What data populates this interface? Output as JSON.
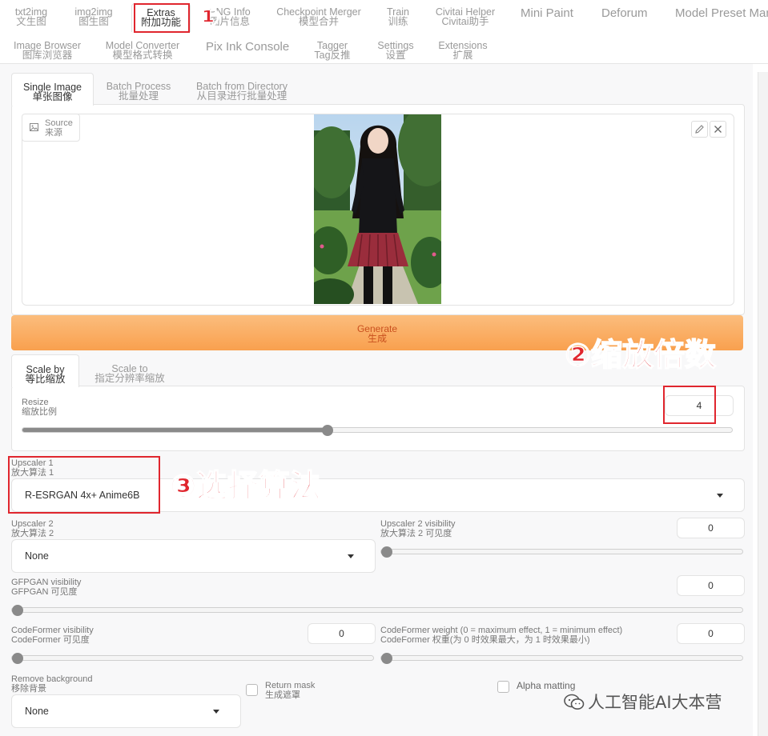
{
  "top_tabs_row1": [
    {
      "en": "txt2img",
      "cn": "文生图"
    },
    {
      "en": "img2img",
      "cn": "图生图"
    },
    {
      "en": "Extras",
      "cn": "附加功能"
    },
    {
      "en": "PNG Info",
      "cn": "图片信息"
    },
    {
      "en": "Checkpoint Merger",
      "cn": "模型合并"
    },
    {
      "en": "Train",
      "cn": "训练"
    },
    {
      "en": "Civitai Helper",
      "cn": "Civitai助手"
    },
    {
      "en": "Mini Paint"
    },
    {
      "en": "Deforum"
    },
    {
      "en": "Model Preset Manager"
    }
  ],
  "top_tabs_row2": [
    {
      "en": "Image Browser",
      "cn": "图库浏览器"
    },
    {
      "en": "Model Converter",
      "cn": "模型格式转换"
    },
    {
      "en": "Pix Ink Console"
    },
    {
      "en": "Tagger",
      "cn": "Tag反推"
    },
    {
      "en": "Settings",
      "cn": "设置"
    },
    {
      "en": "Extensions",
      "cn": "扩展"
    }
  ],
  "sub_tabs": [
    {
      "en": "Single Image",
      "cn": "单张图像"
    },
    {
      "en": "Batch Process",
      "cn": "批量处理"
    },
    {
      "en": "Batch from Directory",
      "cn": "从目录进行批量处理"
    }
  ],
  "source": {
    "en": "Source",
    "cn": "来源"
  },
  "generate": {
    "en": "Generate",
    "cn": "生成"
  },
  "scale_tabs": [
    {
      "en": "Scale by",
      "cn": "等比缩放"
    },
    {
      "en": "Scale to",
      "cn": "指定分辨率缩放"
    }
  ],
  "resize": {
    "en": "Resize",
    "cn": "缩放比例",
    "value": "4",
    "fraction": 0.43
  },
  "upscaler1": {
    "en": "Upscaler 1",
    "cn": "放大算法 1",
    "value": "R-ESRGAN 4x+ Anime6B"
  },
  "upscaler2": {
    "en": "Upscaler 2",
    "cn": "放大算法 2",
    "value": "None"
  },
  "upscaler2_visibility": {
    "en": "Upscaler 2 visibility",
    "cn": "放大算法 2 可见度",
    "value": "0",
    "fraction": 0
  },
  "gfpgan": {
    "en": "GFPGAN visibility",
    "cn": "GFPGAN 可见度",
    "value": "0",
    "fraction": 0
  },
  "codeformer_vis": {
    "en": "CodeFormer visibility",
    "cn": "CodeFormer 可见度",
    "value": "0",
    "fraction": 0
  },
  "codeformer_weight": {
    "en": "CodeFormer weight (0 = maximum effect, 1 = minimum effect)",
    "cn": "CodeFormer 权重(为 0 时效果最大，为 1 时效果最小)",
    "value": "0",
    "fraction": 0
  },
  "remove_bg": {
    "en": "Remove background",
    "cn": "移除背景",
    "value": "None"
  },
  "return_mask": {
    "en": "Return mask",
    "cn": "生成遮罩"
  },
  "alpha_matting": {
    "en": "Alpha matting"
  },
  "annotations": {
    "a1": "①",
    "a2": "②缩放倍数",
    "a3": "③选择算法"
  },
  "watermark": "人工智能AI大本营",
  "colors": {
    "accent_orange": "#f7a24a",
    "annotation_red": "#e0262e"
  }
}
